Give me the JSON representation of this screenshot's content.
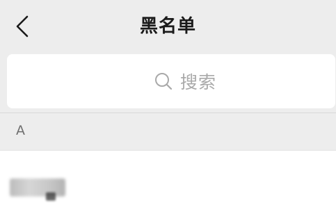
{
  "nav": {
    "title": "黑名单",
    "back_icon": "chevron-left-icon"
  },
  "search": {
    "icon": "search-icon",
    "placeholder": "搜索"
  },
  "sections": [
    {
      "letter": "A",
      "contacts": [
        {
          "name": "",
          "redacted": true
        }
      ]
    }
  ]
}
